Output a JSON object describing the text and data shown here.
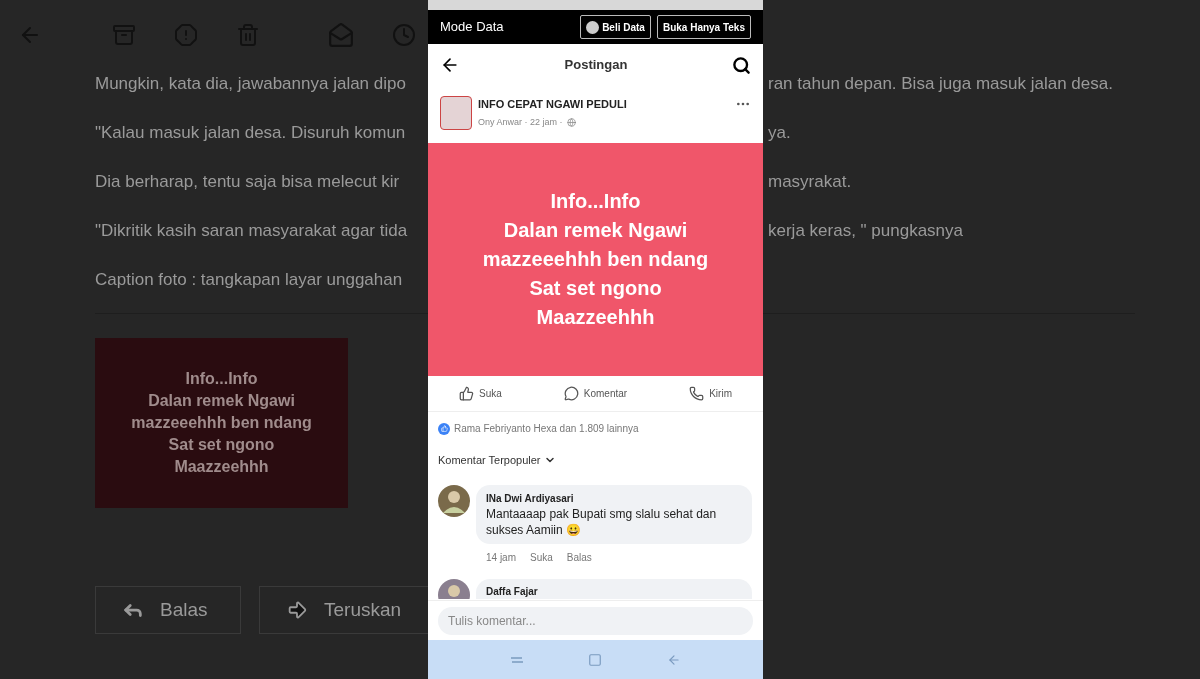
{
  "email": {
    "paragraphs": [
      {
        "left": "Mungkin, kata dia, jawabannya jalan dipo",
        "right": "ran tahun depan. Bisa juga masuk jalan desa."
      },
      {
        "left": "\"Kalau masuk jalan desa. Disuruh komun",
        "right": "ya."
      },
      {
        "left": "Dia berharap, tentu saja  bisa melecut kir",
        "right": "masyrakat."
      },
      {
        "left": "\"Dikritik kasih saran masyarakat agar tida",
        "right": "kerja keras, \" pungkasnya"
      },
      {
        "left": "Caption foto : tangkapan layar unggahan"
      }
    ],
    "image_lines": [
      "Info...Info",
      "Dalan remek Ngawi",
      "mazzeeehhh ben ndang",
      "Sat set ngono",
      "Maazzeehhh"
    ],
    "reply_buttons": [
      {
        "kind": "reply",
        "label": "Balas"
      },
      {
        "kind": "forward",
        "label": "Teruskan"
      }
    ]
  },
  "phone": {
    "data_bar": {
      "title": "Mode Data",
      "buttons": [
        {
          "label": "Beli Data",
          "icon": true
        },
        {
          "label": "Buka Hanya Teks",
          "icon": false
        }
      ]
    },
    "header": {
      "title": "Postingan"
    },
    "post": {
      "page": "INFO CEPAT NGAWI PEDULI",
      "meta": "Ony Anwar · 22 jam ·",
      "lines": [
        "Info...Info",
        "Dalan remek Ngawi",
        "mazzeeehhh ben ndang",
        "Sat set ngono",
        "Maazzeehhh"
      ]
    },
    "actions": [
      {
        "kind": "like",
        "label": "Suka"
      },
      {
        "kind": "comment",
        "label": "Komentar"
      },
      {
        "kind": "send",
        "label": "Kirim"
      }
    ],
    "reactions": "Rama Febriyanto Hexa dan 1.809 lainnya",
    "sort": "Komentar Terpopuler",
    "comments": [
      {
        "name": "INa Dwi Ardiyasari",
        "text": "Mantaaaap pak Bupati smg slalu sehat dan sukses Aamiin 😀",
        "time": "14 jam",
        "like": "Suka",
        "reply": "Balas"
      },
      {
        "name": "Daffa Fajar"
      }
    ],
    "input": {
      "placeholder": "Tulis komentar..."
    }
  }
}
